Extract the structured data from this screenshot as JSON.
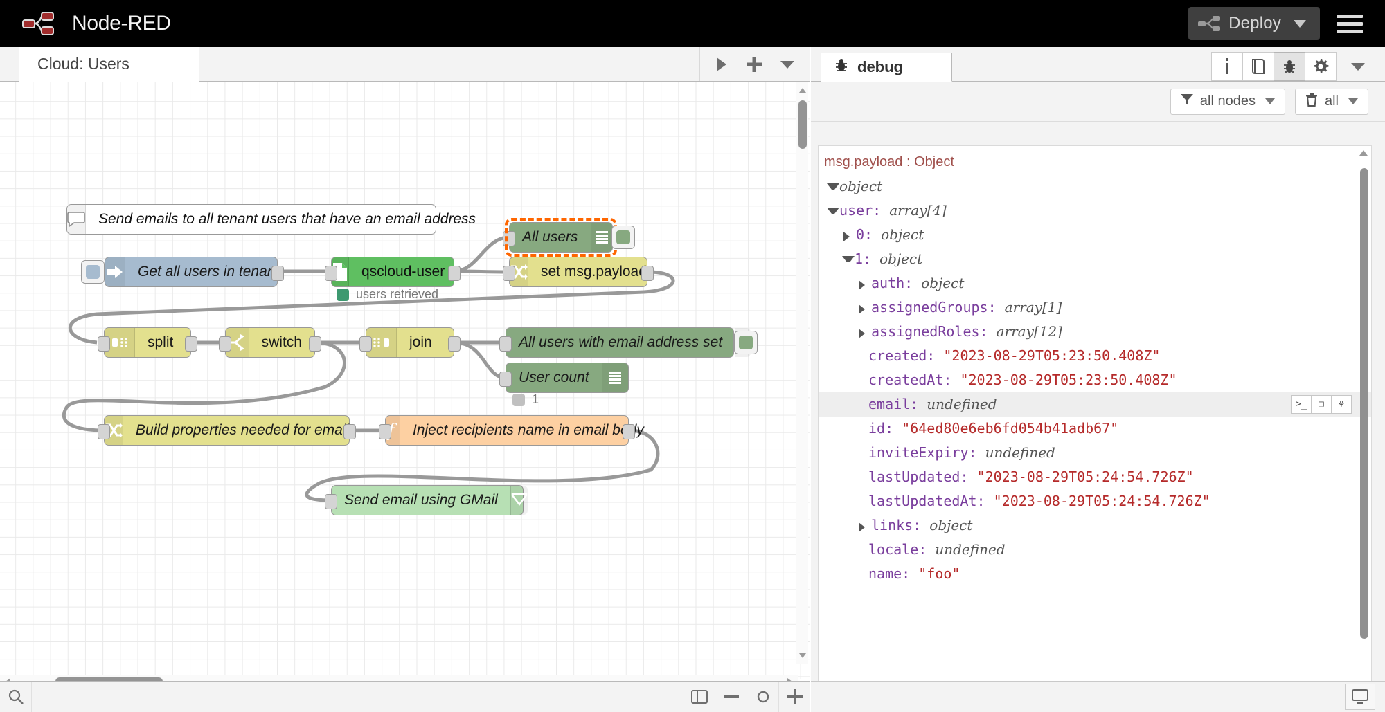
{
  "header": {
    "app_title": "Node-RED",
    "deploy_label": "Deploy",
    "logo_color": "#8f3330",
    "deploy_bg": "#3f3f3f",
    "icons": {
      "deploy": "deploy-icon",
      "caret": "chevron-down-icon",
      "menu": "hamburger-menu-icon"
    }
  },
  "workspace": {
    "tab_label": "Cloud: Users",
    "toolbar_icons": [
      "play-icon",
      "plus-icon",
      "chevron-down-icon"
    ],
    "footer_icons": [
      "search-icon",
      "view-layout-icon",
      "zoom-out-icon",
      "zoom-reset-icon",
      "zoom-in-icon"
    ]
  },
  "flow": {
    "comment": {
      "label": "Send emails to all tenant users that have an email address",
      "icon": "comment-icon"
    },
    "nodes": [
      {
        "id": "get-users",
        "label": "Get all users in tenant",
        "icon": "link-in-icon",
        "color": "n-blue"
      },
      {
        "id": "qscloud",
        "label": "qscloud-user",
        "icon": "file-icon",
        "color": "n-green"
      },
      {
        "id": "all-users",
        "label": "All users",
        "icon": "debug-icon",
        "color": "n-debug"
      },
      {
        "id": "set-payload",
        "label": "set msg.payload",
        "icon": "change-icon",
        "color": "n-yellow"
      },
      {
        "id": "split",
        "label": "split",
        "icon": "split-icon",
        "color": "n-yellow"
      },
      {
        "id": "switch",
        "label": "switch",
        "icon": "switch-icon",
        "color": "n-yellow"
      },
      {
        "id": "join",
        "label": "join",
        "icon": "join-icon",
        "color": "n-yellow"
      },
      {
        "id": "all-email",
        "label": "All users with email address set",
        "icon": "debug-icon",
        "color": "n-debug"
      },
      {
        "id": "user-count",
        "label": "User count",
        "icon": "debug-icon",
        "color": "n-debug"
      },
      {
        "id": "build-props",
        "label": "Build properties needed for email",
        "icon": "change-icon",
        "color": "n-yellow"
      },
      {
        "id": "inject-name",
        "label": "Inject recipients name in email body",
        "icon": "function-icon",
        "color": "n-orange"
      },
      {
        "id": "send-gmail",
        "label": "Send email using GMail",
        "icon": "envelope-icon",
        "color": "n-mint"
      }
    ],
    "status": {
      "qscloud": "users retrieved",
      "user_count": "1"
    }
  },
  "sidebar": {
    "tab_label": "debug",
    "tab_icon": "bug-icon",
    "tools": [
      {
        "name": "info-icon",
        "glyph": "i",
        "active": false
      },
      {
        "name": "help-icon",
        "glyph": "book",
        "active": false
      },
      {
        "name": "debug-icon",
        "glyph": "bug",
        "active": true
      },
      {
        "name": "config-icon",
        "glyph": "gear",
        "active": false
      }
    ],
    "expand_icon": "chevron-down-icon",
    "filter": {
      "nodes_label": "all nodes",
      "nodes_icon": "filter-icon",
      "clear_label": "all",
      "clear_icon": "trash-icon"
    },
    "footer_icon": "monitor-icon"
  },
  "debug_message": {
    "header": "msg.payload : Object",
    "rows": [
      {
        "indent": 0,
        "twisty": "open",
        "key": "",
        "sep": "",
        "value": "object",
        "vtype": "type"
      },
      {
        "indent": 0,
        "twisty": "open",
        "key": "user",
        "sep": ": ",
        "value": "array[4]",
        "vtype": "type"
      },
      {
        "indent": 1,
        "twisty": "closed",
        "key": "0",
        "sep": ": ",
        "value": "object",
        "vtype": "type"
      },
      {
        "indent": 1,
        "twisty": "open",
        "key": "1",
        "sep": ": ",
        "value": "object",
        "vtype": "type"
      },
      {
        "indent": 2,
        "twisty": "closed",
        "key": "auth",
        "sep": ": ",
        "value": "object",
        "vtype": "type"
      },
      {
        "indent": 2,
        "twisty": "closed",
        "key": "assignedGroups",
        "sep": ": ",
        "value": "array[1]",
        "vtype": "type"
      },
      {
        "indent": 2,
        "twisty": "closed",
        "key": "assignedRoles",
        "sep": ": ",
        "value": "array[12]",
        "vtype": "type"
      },
      {
        "indent": 2,
        "twisty": "none",
        "key": "created",
        "sep": ": ",
        "value": "\"2023-08-29T05:23:50.408Z\"",
        "vtype": "str"
      },
      {
        "indent": 2,
        "twisty": "none",
        "key": "createdAt",
        "sep": ": ",
        "value": "\"2023-08-29T05:23:50.408Z\"",
        "vtype": "str"
      },
      {
        "indent": 2,
        "twisty": "none",
        "key": "email",
        "sep": ": ",
        "value": "undefined",
        "vtype": "type",
        "highlight": true,
        "actions": [
          "terminal-icon",
          "copy-icon",
          "pin-icon"
        ]
      },
      {
        "indent": 2,
        "twisty": "none",
        "key": "id",
        "sep": ": ",
        "value": "\"64ed80e6eb6fd054b41adb67\"",
        "vtype": "str"
      },
      {
        "indent": 2,
        "twisty": "none",
        "key": "inviteExpiry",
        "sep": ": ",
        "value": "undefined",
        "vtype": "type"
      },
      {
        "indent": 2,
        "twisty": "none",
        "key": "lastUpdated",
        "sep": ": ",
        "value": "\"2023-08-29T05:24:54.726Z\"",
        "vtype": "str"
      },
      {
        "indent": 2,
        "twisty": "none",
        "key": "lastUpdatedAt",
        "sep": ": ",
        "value": "\"2023-08-29T05:24:54.726Z\"",
        "vtype": "str"
      },
      {
        "indent": 2,
        "twisty": "closed",
        "key": "links",
        "sep": ": ",
        "value": "object",
        "vtype": "type"
      },
      {
        "indent": 2,
        "twisty": "none",
        "key": "locale",
        "sep": ": ",
        "value": "undefined",
        "vtype": "type"
      },
      {
        "indent": 2,
        "twisty": "none",
        "key": "name",
        "sep": ": ",
        "value": "\"foo\"",
        "vtype": "str"
      }
    ]
  }
}
